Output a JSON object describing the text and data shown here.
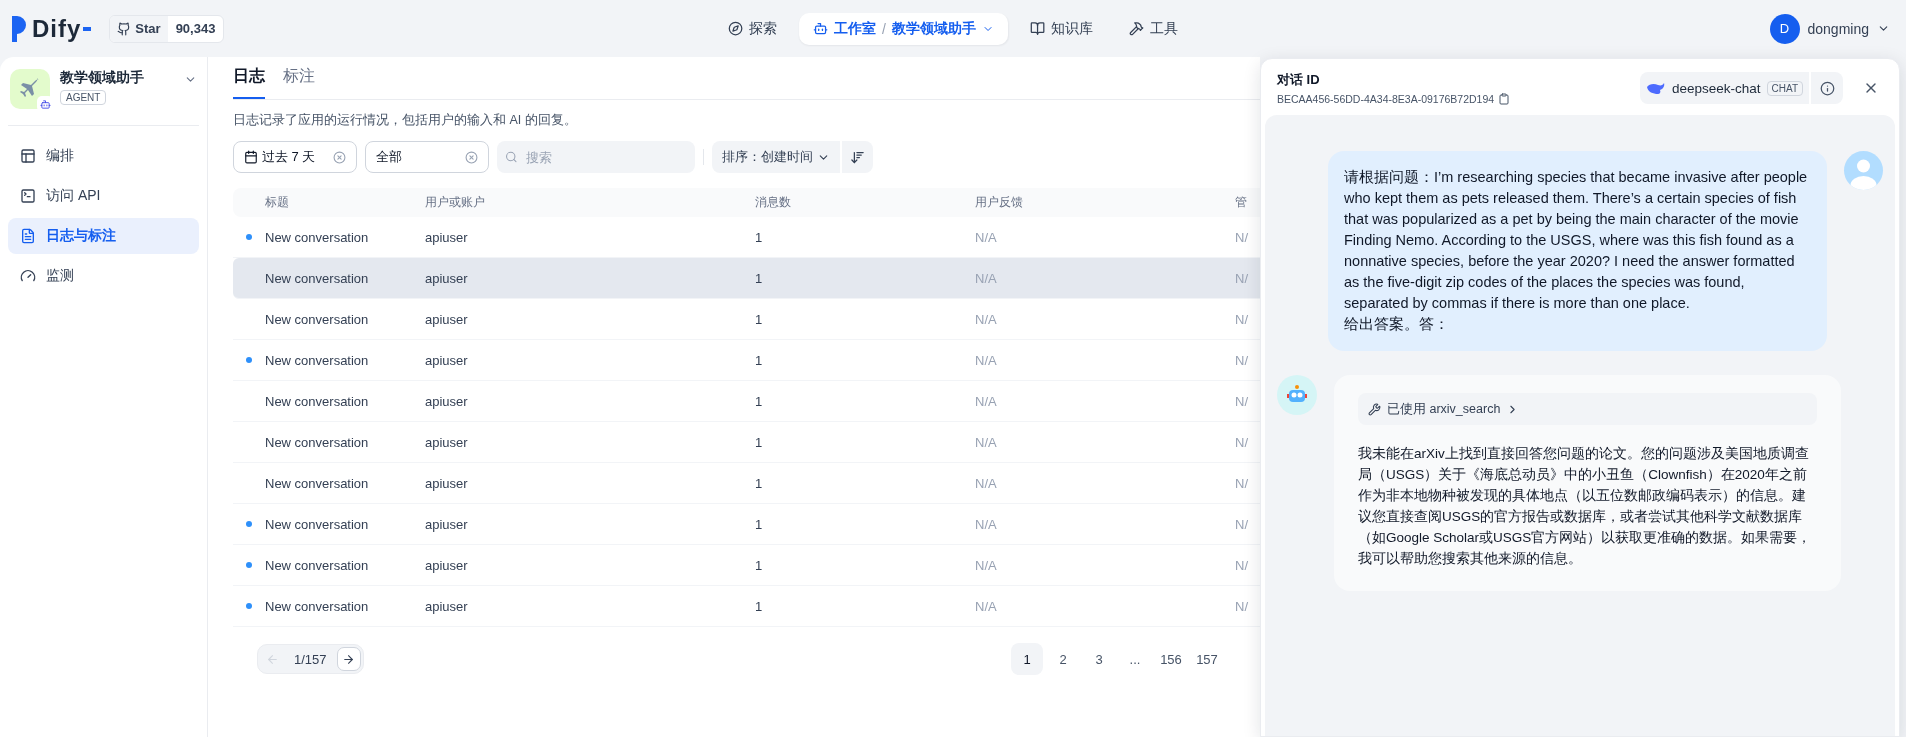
{
  "header": {
    "logo": "Dify",
    "github": {
      "label": "Star",
      "count": "90,343"
    },
    "nav": [
      {
        "label": "探索",
        "selected": false
      },
      {
        "label": "工作室",
        "selected": true,
        "separator": "/",
        "crumb": "教学领域助手"
      },
      {
        "label": "知识库",
        "selected": false
      },
      {
        "label": "工具",
        "selected": false
      }
    ],
    "user": {
      "initial": "D",
      "name": "dongming"
    }
  },
  "sidebar": {
    "app": {
      "name": "教学领域助手",
      "badge": "AGENT"
    },
    "items": [
      {
        "label": "编排",
        "selected": false
      },
      {
        "label": "访问 API",
        "selected": false
      },
      {
        "label": "日志与标注",
        "selected": true
      },
      {
        "label": "监测",
        "selected": false
      }
    ]
  },
  "tabs": [
    {
      "label": "日志",
      "selected": true
    },
    {
      "label": "标注",
      "selected": false
    }
  ],
  "description": "日志记录了应用的运行情况，包括用户的输入和 AI 的回复。",
  "filters": {
    "date": "过去 7 天",
    "status": "全部",
    "search": {
      "placeholder": "搜索"
    },
    "sort": {
      "label": "排序：",
      "value": "创建时间"
    }
  },
  "table": {
    "columns": [
      "标题",
      "用户或账户",
      "消息数",
      "用户反馈",
      "管"
    ],
    "rows": [
      {
        "unread": true,
        "selected": false,
        "cells": [
          "New conversation",
          "apiuser",
          "1",
          "N/A",
          "N/"
        ]
      },
      {
        "unread": false,
        "selected": true,
        "cells": [
          "New conversation",
          "apiuser",
          "1",
          "N/A",
          "N/"
        ]
      },
      {
        "unread": false,
        "selected": false,
        "cells": [
          "New conversation",
          "apiuser",
          "1",
          "N/A",
          "N/"
        ]
      },
      {
        "unread": true,
        "selected": false,
        "cells": [
          "New conversation",
          "apiuser",
          "1",
          "N/A",
          "N/"
        ]
      },
      {
        "unread": false,
        "selected": false,
        "cells": [
          "New conversation",
          "apiuser",
          "1",
          "N/A",
          "N/"
        ]
      },
      {
        "unread": false,
        "selected": false,
        "cells": [
          "New conversation",
          "apiuser",
          "1",
          "N/A",
          "N/"
        ]
      },
      {
        "unread": false,
        "selected": false,
        "cells": [
          "New conversation",
          "apiuser",
          "1",
          "N/A",
          "N/"
        ]
      },
      {
        "unread": true,
        "selected": false,
        "cells": [
          "New conversation",
          "apiuser",
          "1",
          "N/A",
          "N/"
        ]
      },
      {
        "unread": true,
        "selected": false,
        "cells": [
          "New conversation",
          "apiuser",
          "1",
          "N/A",
          "N/"
        ]
      },
      {
        "unread": true,
        "selected": false,
        "cells": [
          "New conversation",
          "apiuser",
          "1",
          "N/A",
          "N/"
        ]
      }
    ]
  },
  "pagination": {
    "indicator": "1/157",
    "pages": [
      {
        "label": "1",
        "selected": true
      },
      {
        "label": "2",
        "selected": false
      },
      {
        "label": "3",
        "selected": false
      },
      {
        "label": "...",
        "selected": false
      },
      {
        "label": "156",
        "selected": false
      },
      {
        "label": "157",
        "selected": false
      }
    ]
  },
  "panel": {
    "title": "对话 ID",
    "conversation_id": "BECAA456-56DD-4A34-8E3A-09176B72D194",
    "model": {
      "name": "deepseek-chat",
      "badge": "CHAT"
    },
    "messages": [
      {
        "kind": "user",
        "text": "请根据问题：I’m researching species that became invasive after people who kept them as pets released them. There’s a certain species of fish that was popularized as a pet by being the main character of the movie Finding Nemo. According to the USGS, where was this fish found as a nonnative species, before the year 2020? I need the answer formatted as the five-digit zip codes of the places the species was found, separated by commas if there is more than one place.\n给出答案。答："
      },
      {
        "kind": "assistant",
        "tool": "已使用 arxiv_search",
        "text": "我未能在arXiv上找到直接回答您问题的论文。您的问题涉及美国地质调查局（USGS）关于《海底总动员》中的小丑鱼（Clownfish）在2020年之前作为非本地物种被发现的具体地点（以五位数邮政编码表示）的信息。建议您直接查阅USGS的官方报告或数据库，或者尝试其他科学文献数据库（如Google Scholar或USGS官方网站）以获取更准确的数据。如果需要，我可以帮助您搜索其他来源的信息。"
      }
    ]
  }
}
